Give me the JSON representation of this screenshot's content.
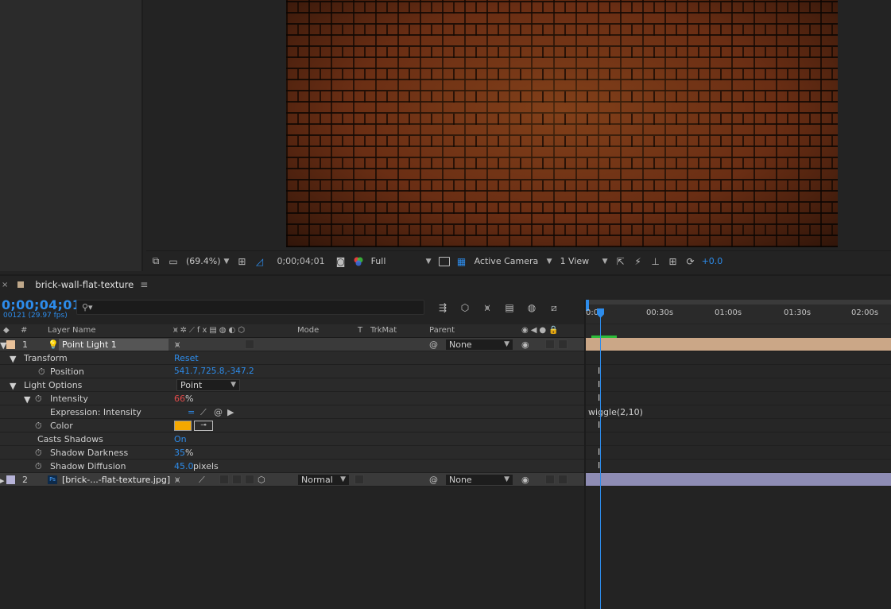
{
  "viewer": {
    "zoom": "(69.4%)",
    "timecode": "0;00;04;01",
    "resolution": "Full",
    "camera": "Active Camera",
    "views": "1 View",
    "exposure": "+0.0"
  },
  "timeline": {
    "tab_title": "brick-wall-flat-texture",
    "current_time": "0;00;04;01",
    "frame_info": "00121 (29.97 fps)",
    "ruler_ticks": [
      "0:00",
      "00:30s",
      "01:00s",
      "01:30s",
      "02:00s"
    ],
    "columns": {
      "number": "#",
      "layer_name": "Layer Name",
      "mode": "Mode",
      "t": "T",
      "trkmat": "TrkMat",
      "parent": "Parent"
    },
    "layers": [
      {
        "index": "1",
        "name": "Point Light 1",
        "parent": "None",
        "label_color": "#e8c19a"
      },
      {
        "index": "2",
        "name": "[brick-...-flat-texture.jpg]",
        "mode": "Normal",
        "parent": "None",
        "label_color": "#b6b3d8"
      }
    ],
    "properties": {
      "transform": "Transform",
      "reset": "Reset",
      "position_label": "Position",
      "position_value": "541.7,725.8,-347.2",
      "light_options": "Light Options",
      "light_type": "Point",
      "intensity_label": "Intensity",
      "intensity_value": "66",
      "intensity_unit": "%",
      "expression_label": "Expression: Intensity",
      "expression_text": "wiggle(2,10)",
      "color_label": "Color",
      "light_color": "#f5a800",
      "casts_shadows_label": "Casts Shadows",
      "casts_shadows_value": "On",
      "shadow_darkness_label": "Shadow Darkness",
      "shadow_darkness_value": "35",
      "shadow_darkness_unit": "%",
      "shadow_diffusion_label": "Shadow Diffusion",
      "shadow_diffusion_value": "45.0",
      "shadow_diffusion_unit": "pixels"
    }
  }
}
